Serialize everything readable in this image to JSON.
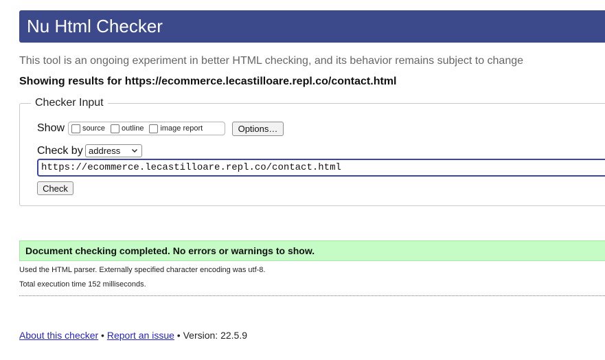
{
  "header": {
    "title": "Nu Html Checker"
  },
  "tagline": "This tool is an ongoing experiment in better HTML checking, and its behavior remains subject to change",
  "showing": "Showing results for https://ecommerce.lecastilloare.repl.co/contact.html",
  "checker_input": {
    "legend": "Checker Input",
    "show_label": "Show",
    "show_options": [
      {
        "label": "source",
        "checked": false
      },
      {
        "label": "outline",
        "checked": false
      },
      {
        "label": "image report",
        "checked": false
      }
    ],
    "options_button": "Options…",
    "check_by_label": "Check by",
    "check_by_value": "address",
    "url_value": "https://ecommerce.lecastilloare.repl.co/contact.html",
    "check_button": "Check"
  },
  "result": {
    "success": "Document checking completed. No errors or warnings to show.",
    "info1": "Used the HTML parser. Externally specified character encoding was utf-8.",
    "info2": "Total execution time 152 milliseconds."
  },
  "footer": {
    "about": "About this checker",
    "sep1": " • ",
    "report": "Report an issue",
    "sep2": " • ",
    "version": "Version: 22.5.9"
  },
  "colors": {
    "header_bg": "#3c4a8c",
    "success_bg": "#c5fcc5",
    "link": "#1a0dab"
  }
}
